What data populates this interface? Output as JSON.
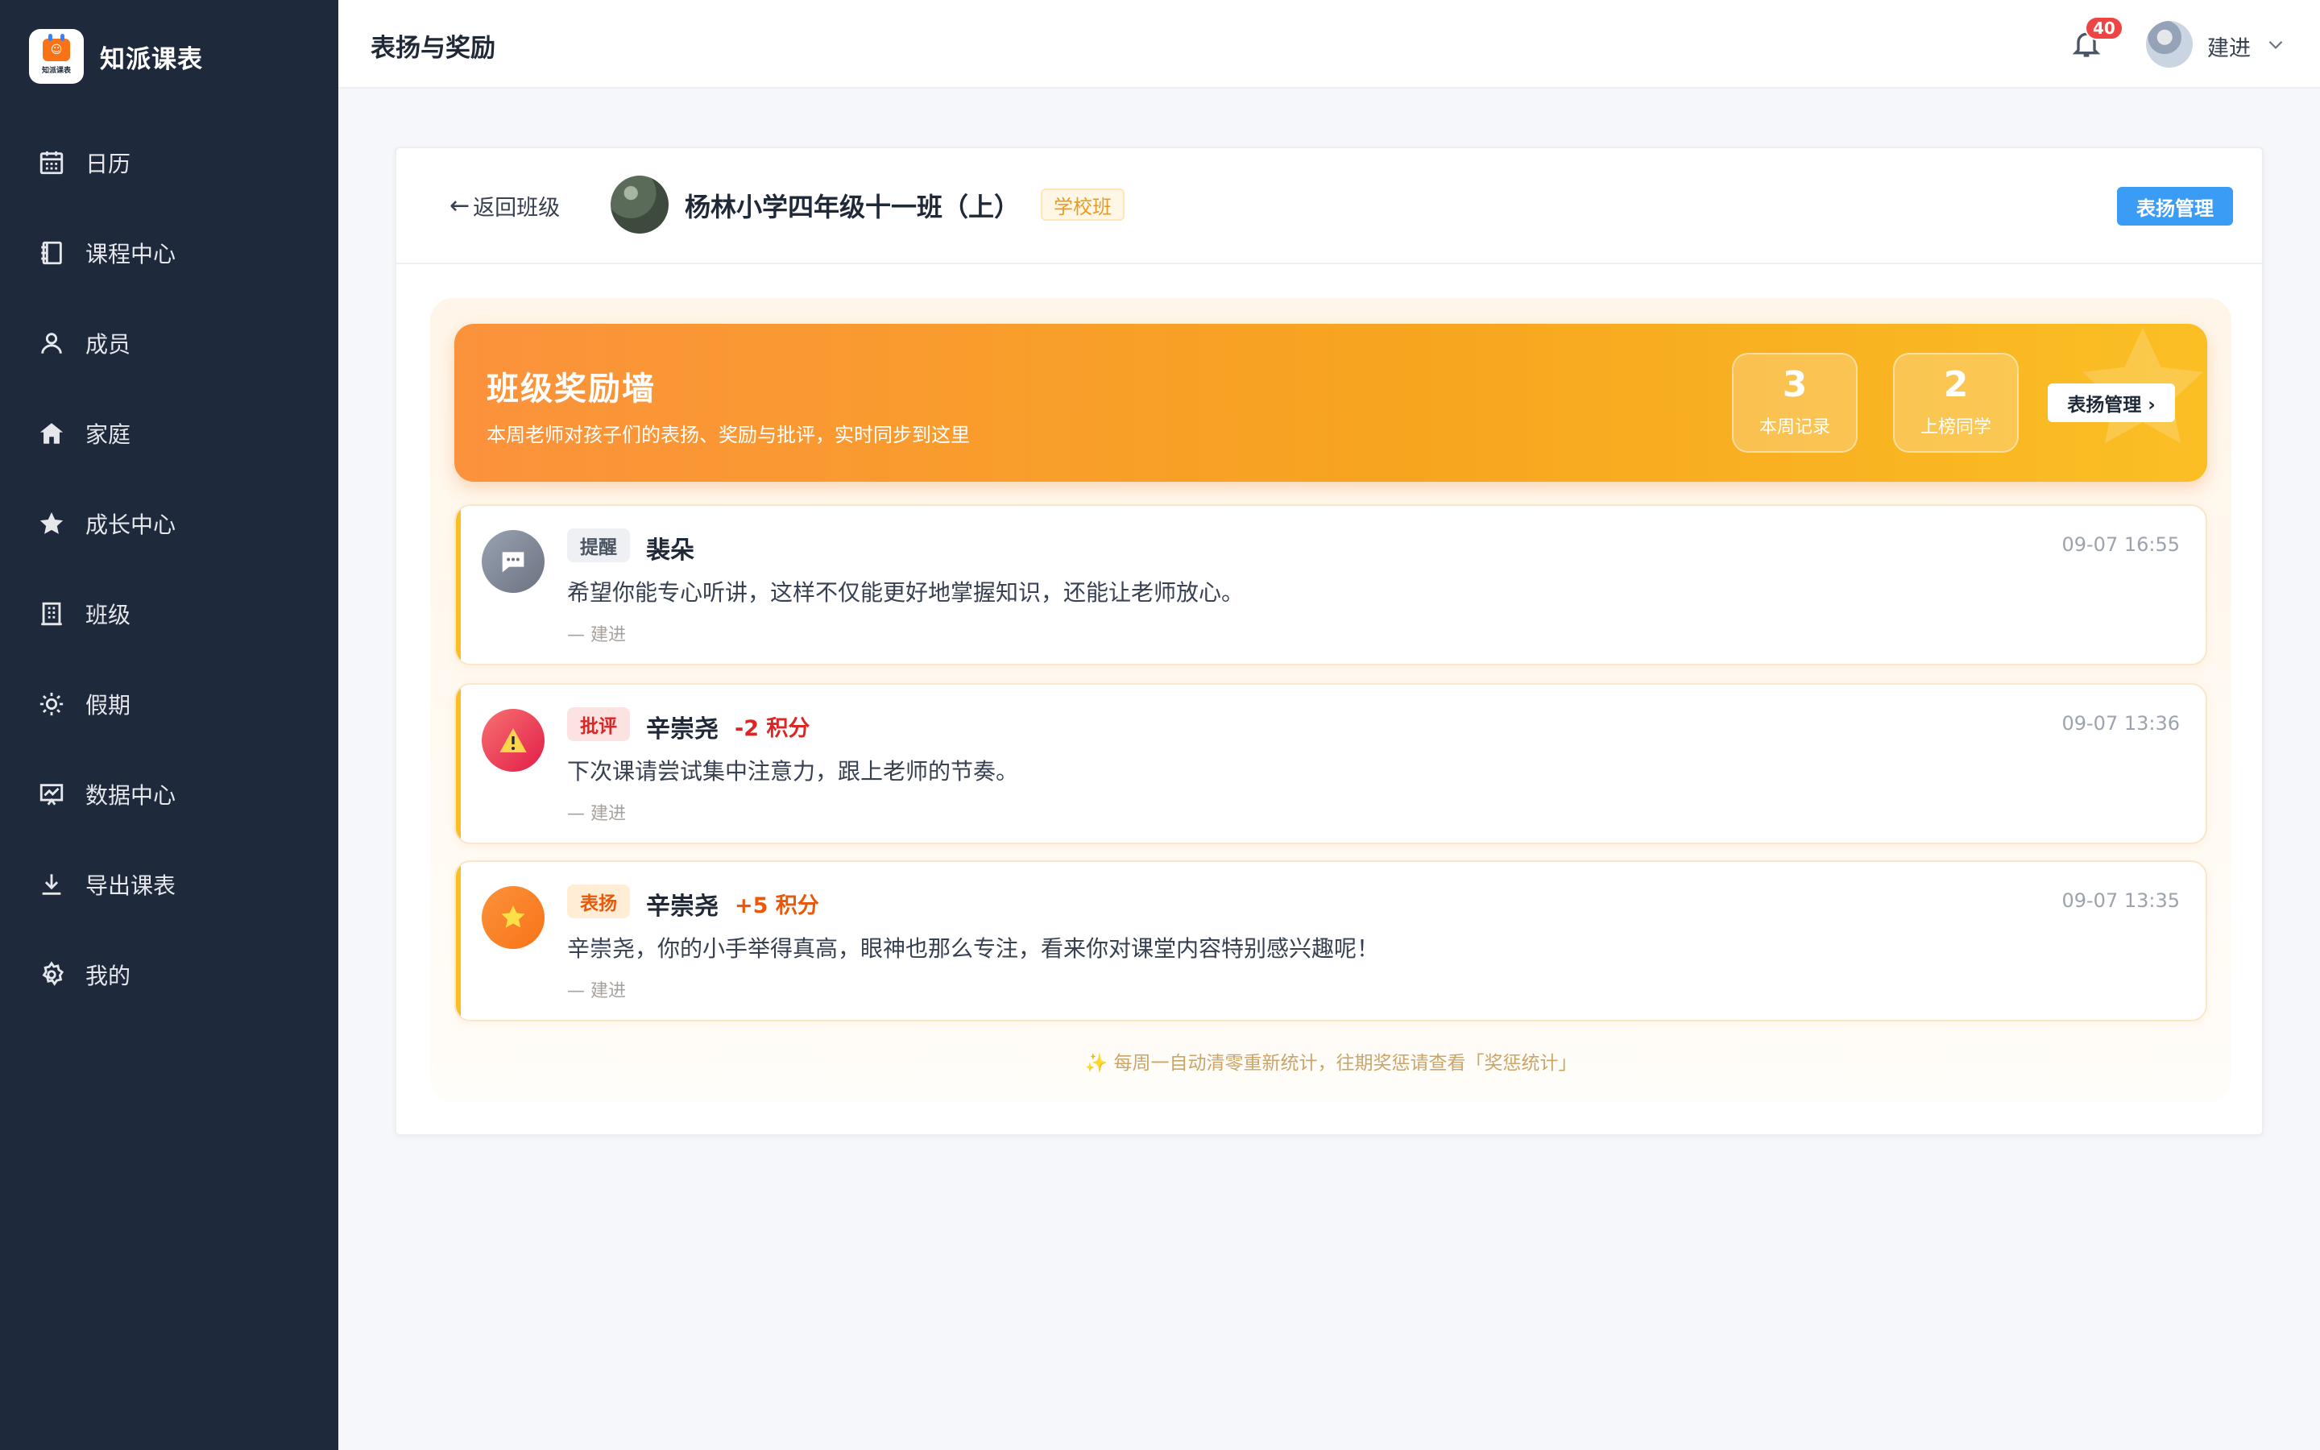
{
  "app": {
    "name": "知派课表",
    "logo_text": "知派课表"
  },
  "sidebar": {
    "items": [
      {
        "label": "日历",
        "icon": "calendar-icon"
      },
      {
        "label": "课程中心",
        "icon": "notebook-icon"
      },
      {
        "label": "成员",
        "icon": "user-icon"
      },
      {
        "label": "家庭",
        "icon": "home-icon"
      },
      {
        "label": "成长中心",
        "icon": "star-icon"
      },
      {
        "label": "班级",
        "icon": "building-icon"
      },
      {
        "label": "假期",
        "icon": "sun-icon"
      },
      {
        "label": "数据中心",
        "icon": "chart-board-icon"
      },
      {
        "label": "导出课表",
        "icon": "download-icon"
      },
      {
        "label": "我的",
        "icon": "gear-icon"
      }
    ]
  },
  "topbar": {
    "title": "表扬与奖励",
    "notification_count": "40",
    "user_name": "建进"
  },
  "class_header": {
    "back_label": "返回班级",
    "back_arrow": "←",
    "class_name": "杨林小学四年级十一班（上）",
    "class_tag": "学校班",
    "manage_button": "表扬管理"
  },
  "banner": {
    "title": "班级奖励墙",
    "subtitle": "本周老师对孩子们的表扬、奖励与批评，实时同步到这里",
    "stats": [
      {
        "value": "3",
        "label": "本周记录"
      },
      {
        "value": "2",
        "label": "上榜同学"
      }
    ],
    "button_label": "表扬管理 ›"
  },
  "records": [
    {
      "type": "提醒",
      "kind": "remind",
      "student": "裴朵",
      "points": "",
      "time": "09-07 16:55",
      "text": "希望你能专心听讲，这样不仅能更好地掌握知识，还能让老师放心。",
      "author": "— 建进",
      "icon": "chat-bubble-icon"
    },
    {
      "type": "批评",
      "kind": "criticize",
      "student": "辛崇尧",
      "points": "-2 积分",
      "time": "09-07 13:36",
      "text": "下次课请尝试集中注意力，跟上老师的节奏。",
      "author": "— 建进",
      "icon": "warning-icon"
    },
    {
      "type": "表扬",
      "kind": "praise",
      "student": "辛崇尧",
      "points": "+5 积分",
      "time": "09-07 13:35",
      "text": "辛崇尧，你的小手举得真高，眼神也那么专注，看来你对课堂内容特别感兴趣呢！",
      "author": "— 建进",
      "icon": "glowing-star-icon"
    }
  ],
  "footnote": "✨ 每周一自动清零重新统计，往期奖惩请查看「奖惩统计」",
  "colors": {
    "sidebar_bg": "#1e293b",
    "accent_blue": "#3b9cf5",
    "banner_orange": "#fb923c",
    "banner_yellow": "#fbbf24",
    "negative_red": "#dc2626",
    "positive_orange": "#ea580c"
  }
}
